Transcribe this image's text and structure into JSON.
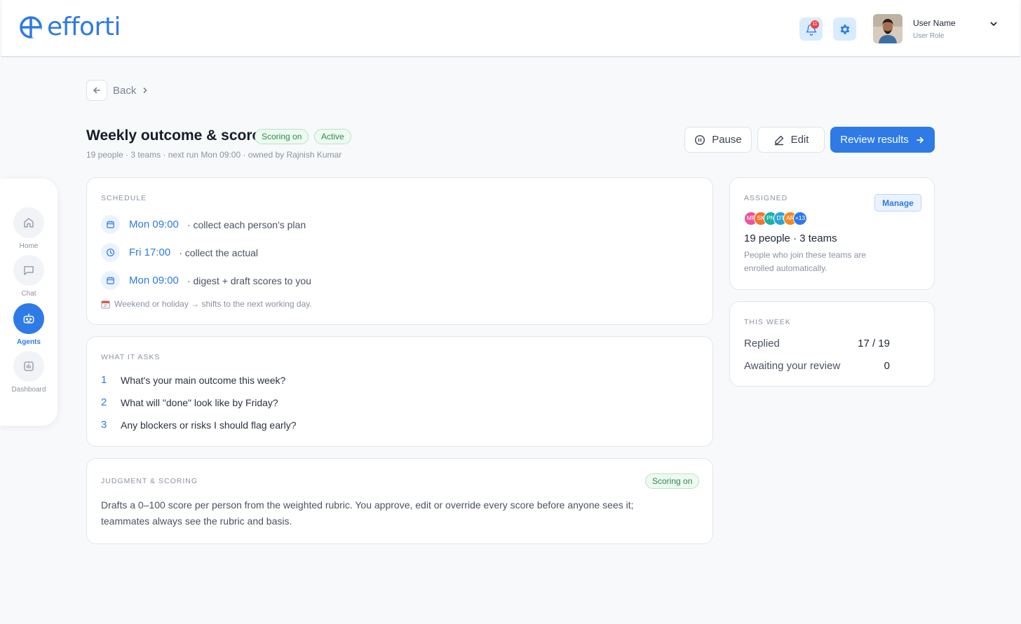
{
  "header": {
    "brand": "efforti",
    "notifications_count": "11",
    "user_name": "User Name",
    "user_role": "User Role"
  },
  "sidenav": {
    "items": [
      {
        "label": "Home",
        "icon": "home-icon",
        "active": false
      },
      {
        "label": "Chat",
        "icon": "chat-icon",
        "active": false
      },
      {
        "label": "Agents",
        "icon": "robot-icon",
        "active": true
      },
      {
        "label": "Dashboard",
        "icon": "chart-icon",
        "active": false
      }
    ]
  },
  "breadcrumb": {
    "back_label": "Back"
  },
  "page": {
    "title": "Weekly outcome & score",
    "badges": [
      "Scoring on",
      "Active"
    ],
    "subtitle": "19 people · 3 teams · next run Mon 09:00 · owned by Rajnish Kumar"
  },
  "actions": {
    "pause_label": "Pause",
    "edit_label": "Edit",
    "review_label": "Review results"
  },
  "schedule": {
    "heading": "SCHEDULE",
    "rows": [
      {
        "icon": "calendar-icon",
        "time": "Mon 09:00",
        "desc": "· collect each person's plan"
      },
      {
        "icon": "clock-icon",
        "time": "Fri 17:00",
        "desc": "· collect the actual"
      },
      {
        "icon": "calendar-icon",
        "time": "Mon 09:00",
        "desc": "· digest + draft scores to you"
      }
    ],
    "note": "Weekend or holiday → shifts to the next working day."
  },
  "questions": {
    "heading": "WHAT IT ASKS",
    "items": [
      {
        "num": "1",
        "text": "What's your main outcome this week?"
      },
      {
        "num": "2",
        "text": "What will \"done\" look like by Friday?"
      },
      {
        "num": "3",
        "text": "Any blockers or risks I should flag early?"
      }
    ]
  },
  "judgment": {
    "heading": "JUDGMENT & SCORING",
    "badge": "Scoring on",
    "text": "Drafts a 0–100 score per person from the weighted rubric. You approve, edit or override every score before anyone sees it; teammates always see the rubric and basis."
  },
  "assigned": {
    "heading": "ASSIGNED",
    "manage_label": "Manage",
    "avatars": [
      {
        "initials": "MF",
        "color": "#e8559b"
      },
      {
        "initials": "SK",
        "color": "#f2752e"
      },
      {
        "initials": "PN",
        "color": "#18b3a4"
      },
      {
        "initials": "DT",
        "color": "#2ba5d9"
      },
      {
        "initials": "AR",
        "color": "#f58a24"
      },
      {
        "initials": "+13",
        "color": "#2e7ae6"
      }
    ],
    "count_text": "19 people · 3 teams",
    "note": "People who join these teams are enrolled automatically."
  },
  "this_week": {
    "heading": "THIS WEEK",
    "stats": [
      {
        "label": "Replied",
        "value": "17 / 19"
      },
      {
        "label": "Awaiting your review",
        "value": "0"
      }
    ]
  },
  "colors": {
    "accent": "#2e7ae6",
    "success": "#2a8a4a",
    "badge_bg": "#eefaf1"
  }
}
